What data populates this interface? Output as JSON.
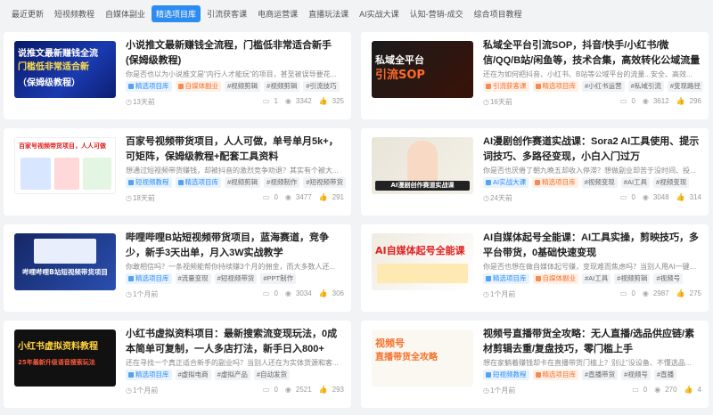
{
  "nav": {
    "items": [
      {
        "label": "最近更新",
        "active": false
      },
      {
        "label": "短视频教程",
        "active": false
      },
      {
        "label": "自媒体副业",
        "active": false
      },
      {
        "label": "精选项目库",
        "active": true
      },
      {
        "label": "引流获客课",
        "active": false
      },
      {
        "label": "电商运营课",
        "active": false
      },
      {
        "label": "直播玩法课",
        "active": false
      },
      {
        "label": "AI实战大课",
        "active": false
      },
      {
        "label": "认知-营销-成交",
        "active": false
      },
      {
        "label": "综合项目教程",
        "active": false
      }
    ]
  },
  "colors": {
    "accent": "#2d8cf0",
    "tag_orange": "#f5712c"
  },
  "cards": [
    {
      "title": "小说推文最新赚钱全流程，门槛低非常适合新手(保姆级教程)",
      "desc": "你是否也以为小说推文是\"内行人才能玩\"的项目，甚至被误导要花...",
      "tags": [
        "精选项目库",
        "自媒体副业",
        "视频剪辑",
        "视频剪辑",
        "引流技巧"
      ],
      "time": "13天前",
      "comments": "1",
      "views": "3342",
      "likes": "325",
      "thumb": {
        "line1": "说推文最新赚钱全流",
        "line2": "门槛低非常适合新",
        "line3": "（保姆级教程）"
      }
    },
    {
      "title": "私域全平台引流SOP，抖音/快手/小红书/微信/QQ/B站/闲鱼等，技术合集，高效转化公域流量",
      "desc": "还在为如何把抖音、小红书、B站等公域平台的流量...安全、高效...",
      "tags": [
        "引流获客课",
        "精选项目库",
        "小红书运营",
        "私域引流",
        "变现路径"
      ],
      "time": "16天前",
      "comments": "0",
      "views": "3612",
      "likes": "296",
      "thumb": {
        "line1": "私域全平台",
        "line2": "引流SOP"
      }
    },
    {
      "title": "百家号视频带货项目，人人可做，单号单月5k+，可矩阵，保姆级教程+配套工具资料",
      "desc": "想通过短视频带货赚钱，却被抖音的激烈竞争劝退？其实有个被大...",
      "tags": [
        "短视频教程",
        "精选项目库",
        "视频剪辑",
        "视频制作",
        "短视频带货"
      ],
      "time": "18天前",
      "comments": "0",
      "views": "3477",
      "likes": "291",
      "thumb": {
        "line1": "百家号视频带货项目，人人可做",
        "line2": "单号单月5k+"
      }
    },
    {
      "title": "AI漫剧创作赛道实战课：Sora2 AI工具使用、提示词技巧、多路径变现，小白入门过万",
      "desc": "你是否也厌倦了朝九晚五却收入停滞？想做副业却苦于没时间、投...",
      "tags": [
        "AI实战大课",
        "精选项目库",
        "视频变现",
        "AI工具",
        "视频变现"
      ],
      "time": "24天前",
      "comments": "0",
      "views": "3048",
      "likes": "314",
      "thumb": {
        "line1": "AI漫剧创作赛道实战课"
      }
    },
    {
      "title": "哔哩哔哩B站短视频带货项目，蓝海赛道，竞争少，新手3天出单，月入3W实战教学",
      "desc": "你敢相信吗？一条视频能帮你持续赚3个月的佣金，而大多数人还...",
      "tags": [
        "精选项目库",
        "流量变现",
        "短视频带货",
        "PPT制作"
      ],
      "time": "1个月前",
      "comments": "0",
      "views": "3034",
      "likes": "306",
      "thumb": {
        "line1": "哔哩哔哩B站短视频带货项目"
      }
    },
    {
      "title": "AI自媒体起号全能课：AI工具实操，剪映技巧，多平台带货，0基础快速变现",
      "desc": "你是否也想在做自媒体起号赚，变现难而焦虑吗？当别人用AI一键生成...",
      "tags": [
        "精选项目库",
        "自媒体副业",
        "AI工具",
        "视频剪辑",
        "视频号"
      ],
      "time": "1个月前",
      "comments": "0",
      "views": "2987",
      "likes": "275",
      "thumb": {
        "line1": "AI自媒体起号全能课"
      }
    },
    {
      "title": "小红书虚拟资料项目：最新搜索流变现玩法，0成本简单可复制，一人多店打法，新手日入800+",
      "desc": "还在寻找一个真正适合新手的副业吗？当别人还在为实体货源和客...",
      "tags": [
        "精选项目库",
        "虚拟电商",
        "虚拟产品",
        "自动发货"
      ],
      "time": "1个月前",
      "comments": "0",
      "views": "2521",
      "likes": "293",
      "thumb": {
        "line1": "小红书虚拟资料教程",
        "line2": "25年最新升级语音搜索玩法"
      }
    },
    {
      "title": "视频号直播带货全攻略：无人直播/选品供应链/素材剪辑去重/复盘技巧，零门槛上手",
      "desc": "想在家躺着赚钱却卡在直播带货门槛上？别让\"没设备、不懂选品...",
      "tags": [
        "短视频教程",
        "精选项目库",
        "直播带货",
        "视频号",
        "直播"
      ],
      "time": "1个月前",
      "comments": "0",
      "views": "270",
      "likes": "4",
      "thumb": {
        "line1": "视频号",
        "line2": "直播带货全攻略"
      }
    }
  ]
}
